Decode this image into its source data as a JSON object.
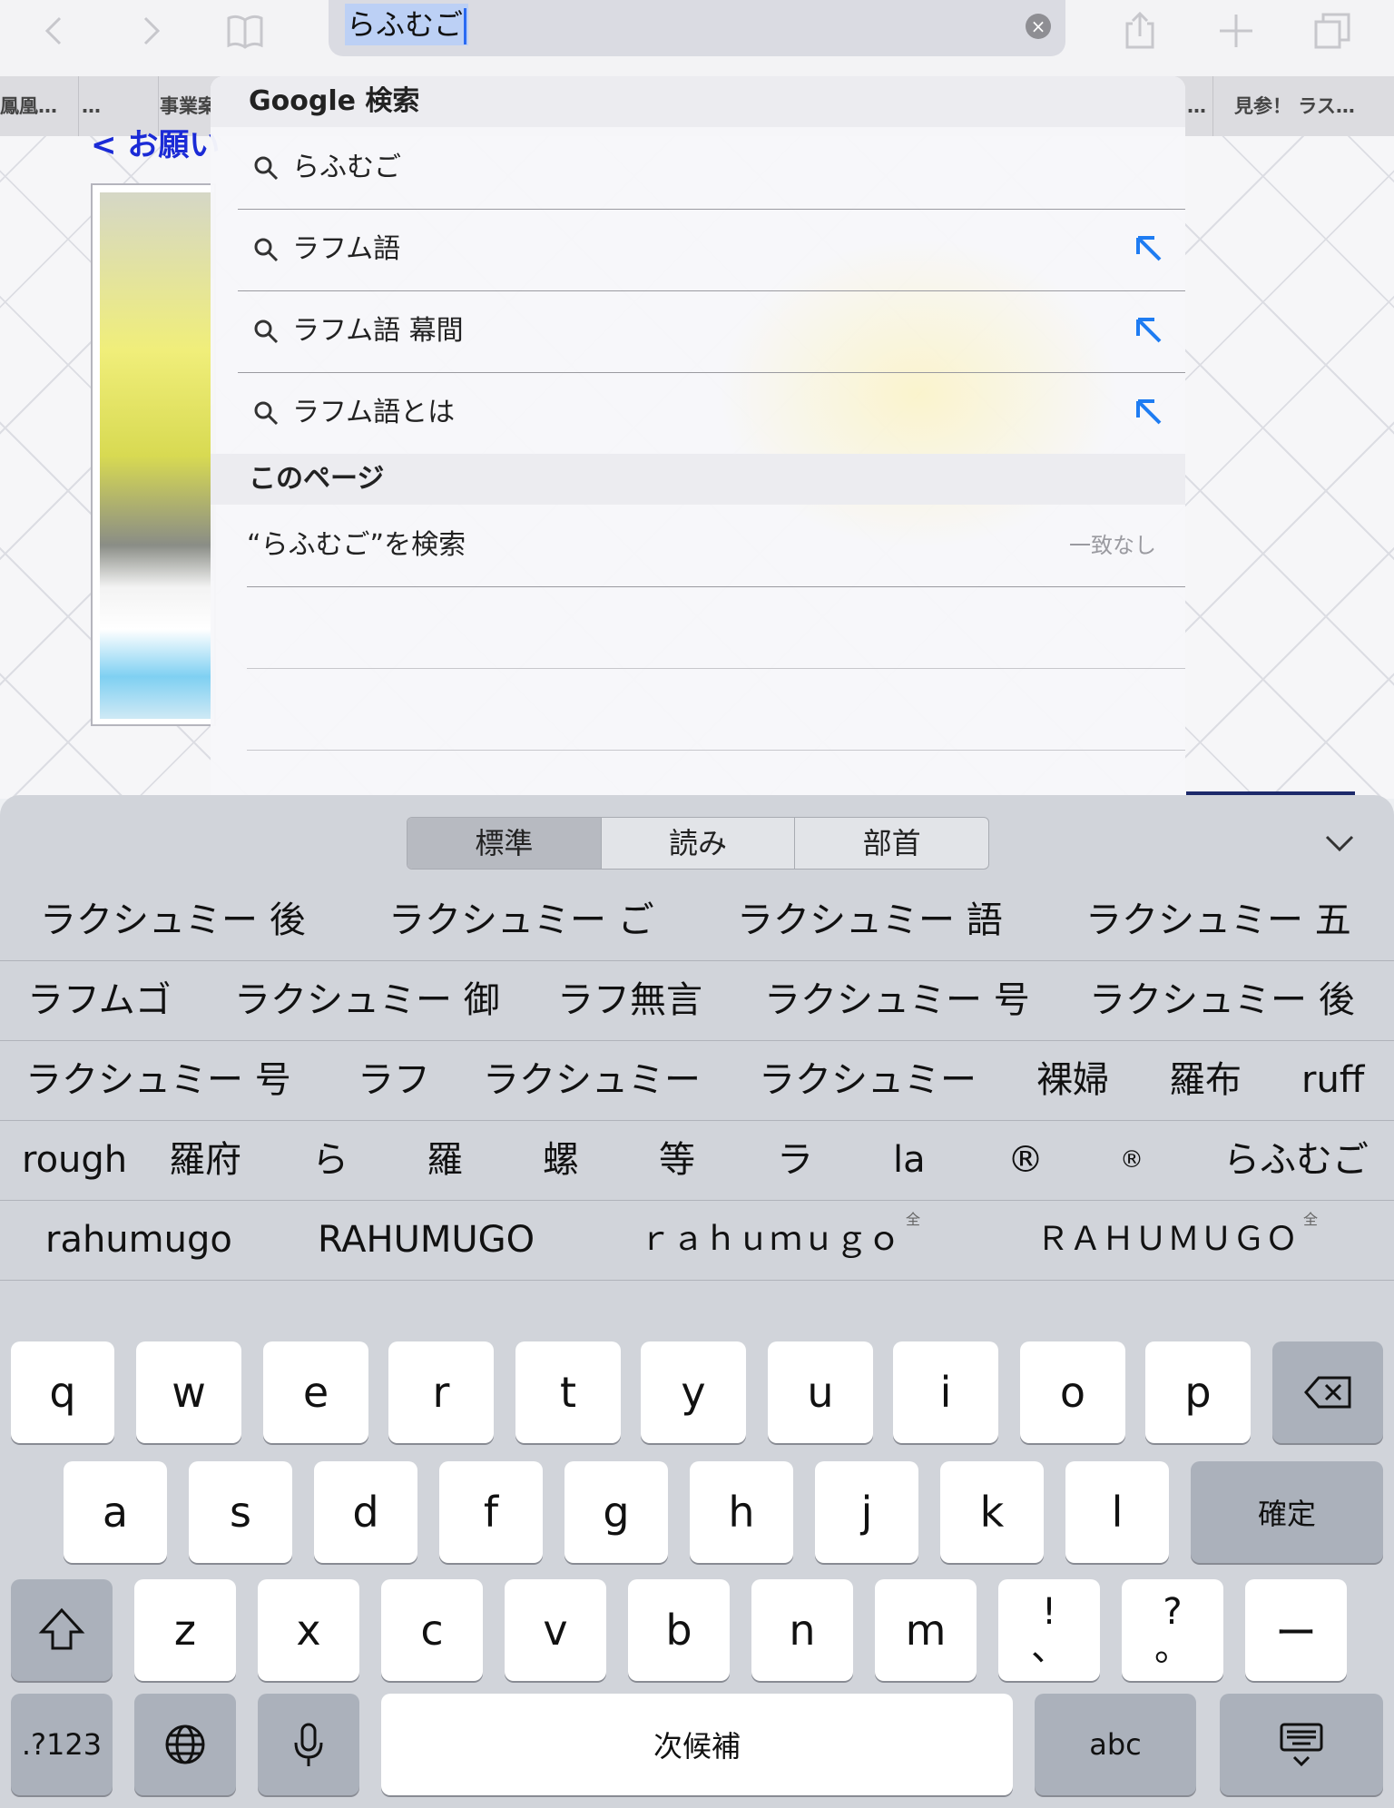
{
  "browser": {
    "url_text": "らふむご",
    "tabs": [
      "鳳凰…",
      "…",
      "事業案",
      "…",
      "見参！ ラス…"
    ]
  },
  "page": {
    "back_link": "< お願い"
  },
  "dropdown": {
    "google_header": "Google 検索",
    "suggestions": [
      {
        "text": "らふむご"
      },
      {
        "text": "ラフム語"
      },
      {
        "text": "ラフム語 幕間"
      },
      {
        "text": "ラフム語とは"
      }
    ],
    "page_header": "このページ",
    "page_find": "“らふむご”を検索",
    "page_find_status": "一致なし"
  },
  "keyboard": {
    "segments": [
      "標準",
      "読み",
      "部首"
    ],
    "candidates": [
      [
        "ラクシュミー 後",
        "ラクシュミー ご",
        "ラクシュミー 語",
        "ラクシュミー 五"
      ],
      [
        "ラフムゴ",
        "ラクシュミー 御",
        "ラフ無言",
        "ラクシュミー 号",
        "ラクシュミー 後"
      ],
      [
        "ラクシュミー 号",
        "ラフ",
        "ラクシュミー",
        "ラクシュミー",
        "裸婦",
        "羅布",
        "ruff"
      ],
      [
        "rough",
        "羅府",
        "ら",
        "羅",
        "螺",
        "等",
        "ラ",
        "la",
        "®",
        "®",
        "らふむご"
      ],
      [
        "rahumugo",
        "RAHUMUGO",
        "ｒａｈｕｍｕｇｏ",
        "ＲＡＨＵＭＵＧＯ"
      ]
    ],
    "fullwidth_mark": "全",
    "row1": [
      "q",
      "w",
      "e",
      "r",
      "t",
      "y",
      "u",
      "i",
      "o",
      "p"
    ],
    "row2": [
      "a",
      "s",
      "d",
      "f",
      "g",
      "h",
      "j",
      "k",
      "l"
    ],
    "row3": [
      "z",
      "x",
      "c",
      "v",
      "b",
      "n",
      "m"
    ],
    "punct1_top": "!",
    "punct1_bottom": "、",
    "punct2_top": "?",
    "punct2_bottom": "。",
    "dash": "ー",
    "confirm": "確定",
    "numbers": ".?123",
    "space": "次候補",
    "abc": "abc"
  }
}
